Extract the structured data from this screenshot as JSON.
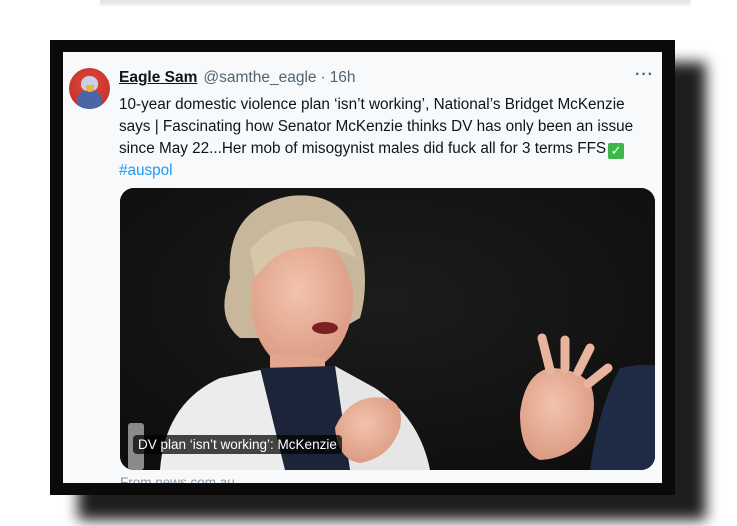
{
  "tweet": {
    "display_name": "Eagle Sam",
    "handle": "@samthe_eagle",
    "separator": "·",
    "time": "16h",
    "more_label": "···",
    "text_lines": [
      "10-year domestic violence plan ‘isn’t working’, National’s Bridget McKenzie",
      "says | Fascinating how Senator McKenzie thinks DV has only been an issue",
      "since May 22...Her mob of misogynist males did fuck all for 3 terms FFS"
    ],
    "check_emoji": "✓",
    "hashtag": "#auspol"
  },
  "media": {
    "caption": "DV plan ‘isn’t working’: McKenzie"
  },
  "link_source": "From news.com.au",
  "icons": {
    "avatar": "eagle-avatar-icon",
    "more": "more-options-icon",
    "check": "check-mark-emoji-icon"
  },
  "colors": {
    "link": "#1d9bf0",
    "secondary_text": "#536471",
    "avatar_bg": "#c8322a",
    "check_bg": "#3fb64c"
  }
}
